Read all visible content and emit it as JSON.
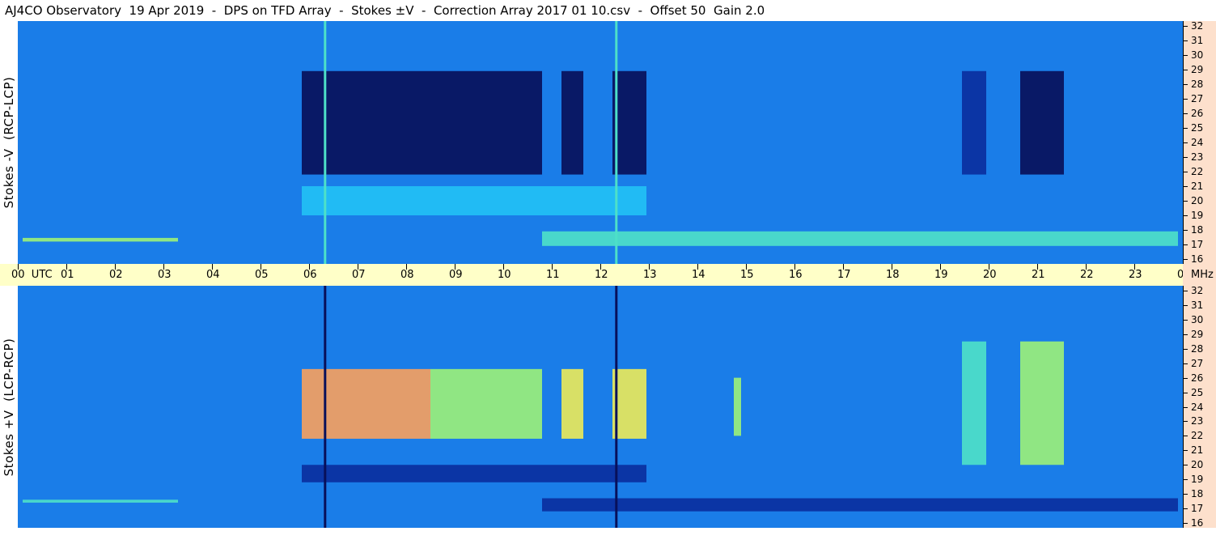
{
  "title": "AJ4CO Observatory  19 Apr 2019  -  DPS on TFD Array  -  Stokes ±V  -  Correction Array 2017 01 10.csv  -  Offset 50  Gain 2.0",
  "colors": {
    "time_axis_bg": "#ffffc8",
    "freq_axis_bg": "#fde0cc",
    "background_blue": "#1a7de8",
    "colormap": [
      "#08105a",
      "#0a2f9e",
      "#1466dc",
      "#1a86f2",
      "#22c0f4",
      "#4de0c8",
      "#9aef7a",
      "#e8e85a",
      "#f4a060",
      "#f06060"
    ]
  },
  "chart_data": {
    "type": "heatmap",
    "time_axis": {
      "labels": [
        "00  UTC",
        "01",
        "02",
        "03",
        "04",
        "05",
        "06",
        "07",
        "08",
        "09",
        "10",
        "11",
        "12",
        "13",
        "14",
        "15",
        "16",
        "17",
        "18",
        "19",
        "20",
        "21",
        "22",
        "23",
        "00"
      ],
      "unit_label": "MHz",
      "range_hours": [
        0,
        24
      ]
    },
    "freq_axis": {
      "labels": [
        "32",
        "31",
        "30",
        "29",
        "28",
        "27",
        "26",
        "25",
        "24",
        "23",
        "22",
        "21",
        "20",
        "19",
        "18",
        "17",
        "16"
      ],
      "range_mhz": [
        16,
        32
      ]
    },
    "panels": [
      {
        "id": "top",
        "ylabel": "Stokes -V  (RCP-LCP)",
        "events": [
          {
            "t": [
              5.85,
              8.5
            ],
            "f": [
              21.8,
              28.9
            ],
            "level": 0.02
          },
          {
            "t": [
              8.5,
              10.8
            ],
            "f": [
              21.8,
              28.9
            ],
            "level": 0.05
          },
          {
            "t": [
              11.2,
              11.65
            ],
            "f": [
              21.8,
              28.9
            ],
            "level": 0.05
          },
          {
            "t": [
              12.25,
              12.95
            ],
            "f": [
              21.8,
              28.9
            ],
            "level": 0.03
          },
          {
            "t": [
              19.45,
              19.95
            ],
            "f": [
              21.8,
              28.9
            ],
            "level": 0.1
          },
          {
            "t": [
              20.65,
              21.55
            ],
            "f": [
              21.8,
              28.9
            ],
            "level": 0.05
          },
          {
            "t": [
              5.85,
              12.95
            ],
            "f": [
              19.0,
              21.0
            ],
            "level": 0.44
          },
          {
            "t": [
              0.1,
              3.3
            ],
            "f": [
              17.2,
              17.45
            ],
            "level": 0.72
          },
          {
            "t": [
              10.8,
              23.9
            ],
            "f": [
              16.9,
              17.9
            ],
            "level": 0.58
          }
        ],
        "spikes": [
          {
            "t": 6.33,
            "level": 0.5
          },
          {
            "t": 12.33,
            "level": 0.5
          }
        ]
      },
      {
        "id": "bottom",
        "ylabel": "Stokes +V  (LCP-RCP)",
        "events": [
          {
            "t": [
              5.85,
              8.5
            ],
            "f": [
              21.8,
              26.6
            ],
            "level": 0.85
          },
          {
            "t": [
              8.5,
              10.8
            ],
            "f": [
              21.8,
              26.6
            ],
            "level": 0.62
          },
          {
            "t": [
              11.2,
              11.65
            ],
            "f": [
              21.8,
              26.6
            ],
            "level": 0.78
          },
          {
            "t": [
              12.25,
              12.95
            ],
            "f": [
              21.8,
              26.6
            ],
            "level": 0.75
          },
          {
            "t": [
              14.75,
              14.9
            ],
            "f": [
              22.0,
              26.0
            ],
            "level": 0.7
          },
          {
            "t": [
              19.45,
              19.95
            ],
            "f": [
              20.0,
              28.5
            ],
            "level": 0.6
          },
          {
            "t": [
              20.65,
              21.55
            ],
            "f": [
              20.0,
              28.5
            ],
            "level": 0.62
          },
          {
            "t": [
              5.85,
              12.95
            ],
            "f": [
              18.8,
              20.0
            ],
            "level": 0.06
          },
          {
            "t": [
              0.1,
              3.3
            ],
            "f": [
              17.4,
              17.6
            ],
            "level": 0.55
          },
          {
            "t": [
              10.8,
              23.9
            ],
            "f": [
              16.8,
              17.7
            ],
            "level": 0.1
          }
        ],
        "spikes": [
          {
            "t": 6.33,
            "level": 0.0
          },
          {
            "t": 12.33,
            "level": 0.0
          }
        ]
      }
    ]
  }
}
